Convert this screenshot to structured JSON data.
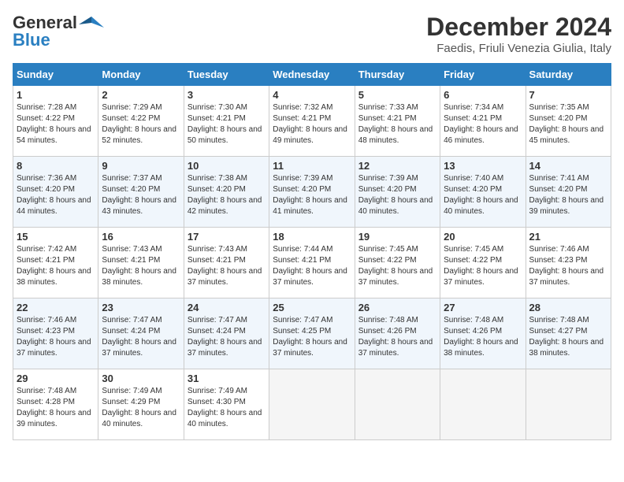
{
  "logo": {
    "line1": "General",
    "line2": "Blue"
  },
  "title": "December 2024",
  "location": "Faedis, Friuli Venezia Giulia, Italy",
  "headers": [
    "Sunday",
    "Monday",
    "Tuesday",
    "Wednesday",
    "Thursday",
    "Friday",
    "Saturday"
  ],
  "weeks": [
    [
      {
        "day": "1",
        "sunrise": "Sunrise: 7:28 AM",
        "sunset": "Sunset: 4:22 PM",
        "daylight": "Daylight: 8 hours and 54 minutes."
      },
      {
        "day": "2",
        "sunrise": "Sunrise: 7:29 AM",
        "sunset": "Sunset: 4:22 PM",
        "daylight": "Daylight: 8 hours and 52 minutes."
      },
      {
        "day": "3",
        "sunrise": "Sunrise: 7:30 AM",
        "sunset": "Sunset: 4:21 PM",
        "daylight": "Daylight: 8 hours and 50 minutes."
      },
      {
        "day": "4",
        "sunrise": "Sunrise: 7:32 AM",
        "sunset": "Sunset: 4:21 PM",
        "daylight": "Daylight: 8 hours and 49 minutes."
      },
      {
        "day": "5",
        "sunrise": "Sunrise: 7:33 AM",
        "sunset": "Sunset: 4:21 PM",
        "daylight": "Daylight: 8 hours and 48 minutes."
      },
      {
        "day": "6",
        "sunrise": "Sunrise: 7:34 AM",
        "sunset": "Sunset: 4:21 PM",
        "daylight": "Daylight: 8 hours and 46 minutes."
      },
      {
        "day": "7",
        "sunrise": "Sunrise: 7:35 AM",
        "sunset": "Sunset: 4:20 PM",
        "daylight": "Daylight: 8 hours and 45 minutes."
      }
    ],
    [
      {
        "day": "8",
        "sunrise": "Sunrise: 7:36 AM",
        "sunset": "Sunset: 4:20 PM",
        "daylight": "Daylight: 8 hours and 44 minutes."
      },
      {
        "day": "9",
        "sunrise": "Sunrise: 7:37 AM",
        "sunset": "Sunset: 4:20 PM",
        "daylight": "Daylight: 8 hours and 43 minutes."
      },
      {
        "day": "10",
        "sunrise": "Sunrise: 7:38 AM",
        "sunset": "Sunset: 4:20 PM",
        "daylight": "Daylight: 8 hours and 42 minutes."
      },
      {
        "day": "11",
        "sunrise": "Sunrise: 7:39 AM",
        "sunset": "Sunset: 4:20 PM",
        "daylight": "Daylight: 8 hours and 41 minutes."
      },
      {
        "day": "12",
        "sunrise": "Sunrise: 7:39 AM",
        "sunset": "Sunset: 4:20 PM",
        "daylight": "Daylight: 8 hours and 40 minutes."
      },
      {
        "day": "13",
        "sunrise": "Sunrise: 7:40 AM",
        "sunset": "Sunset: 4:20 PM",
        "daylight": "Daylight: 8 hours and 40 minutes."
      },
      {
        "day": "14",
        "sunrise": "Sunrise: 7:41 AM",
        "sunset": "Sunset: 4:20 PM",
        "daylight": "Daylight: 8 hours and 39 minutes."
      }
    ],
    [
      {
        "day": "15",
        "sunrise": "Sunrise: 7:42 AM",
        "sunset": "Sunset: 4:21 PM",
        "daylight": "Daylight: 8 hours and 38 minutes."
      },
      {
        "day": "16",
        "sunrise": "Sunrise: 7:43 AM",
        "sunset": "Sunset: 4:21 PM",
        "daylight": "Daylight: 8 hours and 38 minutes."
      },
      {
        "day": "17",
        "sunrise": "Sunrise: 7:43 AM",
        "sunset": "Sunset: 4:21 PM",
        "daylight": "Daylight: 8 hours and 37 minutes."
      },
      {
        "day": "18",
        "sunrise": "Sunrise: 7:44 AM",
        "sunset": "Sunset: 4:21 PM",
        "daylight": "Daylight: 8 hours and 37 minutes."
      },
      {
        "day": "19",
        "sunrise": "Sunrise: 7:45 AM",
        "sunset": "Sunset: 4:22 PM",
        "daylight": "Daylight: 8 hours and 37 minutes."
      },
      {
        "day": "20",
        "sunrise": "Sunrise: 7:45 AM",
        "sunset": "Sunset: 4:22 PM",
        "daylight": "Daylight: 8 hours and 37 minutes."
      },
      {
        "day": "21",
        "sunrise": "Sunrise: 7:46 AM",
        "sunset": "Sunset: 4:23 PM",
        "daylight": "Daylight: 8 hours and 37 minutes."
      }
    ],
    [
      {
        "day": "22",
        "sunrise": "Sunrise: 7:46 AM",
        "sunset": "Sunset: 4:23 PM",
        "daylight": "Daylight: 8 hours and 37 minutes."
      },
      {
        "day": "23",
        "sunrise": "Sunrise: 7:47 AM",
        "sunset": "Sunset: 4:24 PM",
        "daylight": "Daylight: 8 hours and 37 minutes."
      },
      {
        "day": "24",
        "sunrise": "Sunrise: 7:47 AM",
        "sunset": "Sunset: 4:24 PM",
        "daylight": "Daylight: 8 hours and 37 minutes."
      },
      {
        "day": "25",
        "sunrise": "Sunrise: 7:47 AM",
        "sunset": "Sunset: 4:25 PM",
        "daylight": "Daylight: 8 hours and 37 minutes."
      },
      {
        "day": "26",
        "sunrise": "Sunrise: 7:48 AM",
        "sunset": "Sunset: 4:26 PM",
        "daylight": "Daylight: 8 hours and 37 minutes."
      },
      {
        "day": "27",
        "sunrise": "Sunrise: 7:48 AM",
        "sunset": "Sunset: 4:26 PM",
        "daylight": "Daylight: 8 hours and 38 minutes."
      },
      {
        "day": "28",
        "sunrise": "Sunrise: 7:48 AM",
        "sunset": "Sunset: 4:27 PM",
        "daylight": "Daylight: 8 hours and 38 minutes."
      }
    ],
    [
      {
        "day": "29",
        "sunrise": "Sunrise: 7:48 AM",
        "sunset": "Sunset: 4:28 PM",
        "daylight": "Daylight: 8 hours and 39 minutes."
      },
      {
        "day": "30",
        "sunrise": "Sunrise: 7:49 AM",
        "sunset": "Sunset: 4:29 PM",
        "daylight": "Daylight: 8 hours and 40 minutes."
      },
      {
        "day": "31",
        "sunrise": "Sunrise: 7:49 AM",
        "sunset": "Sunset: 4:30 PM",
        "daylight": "Daylight: 8 hours and 40 minutes."
      },
      null,
      null,
      null,
      null
    ]
  ]
}
